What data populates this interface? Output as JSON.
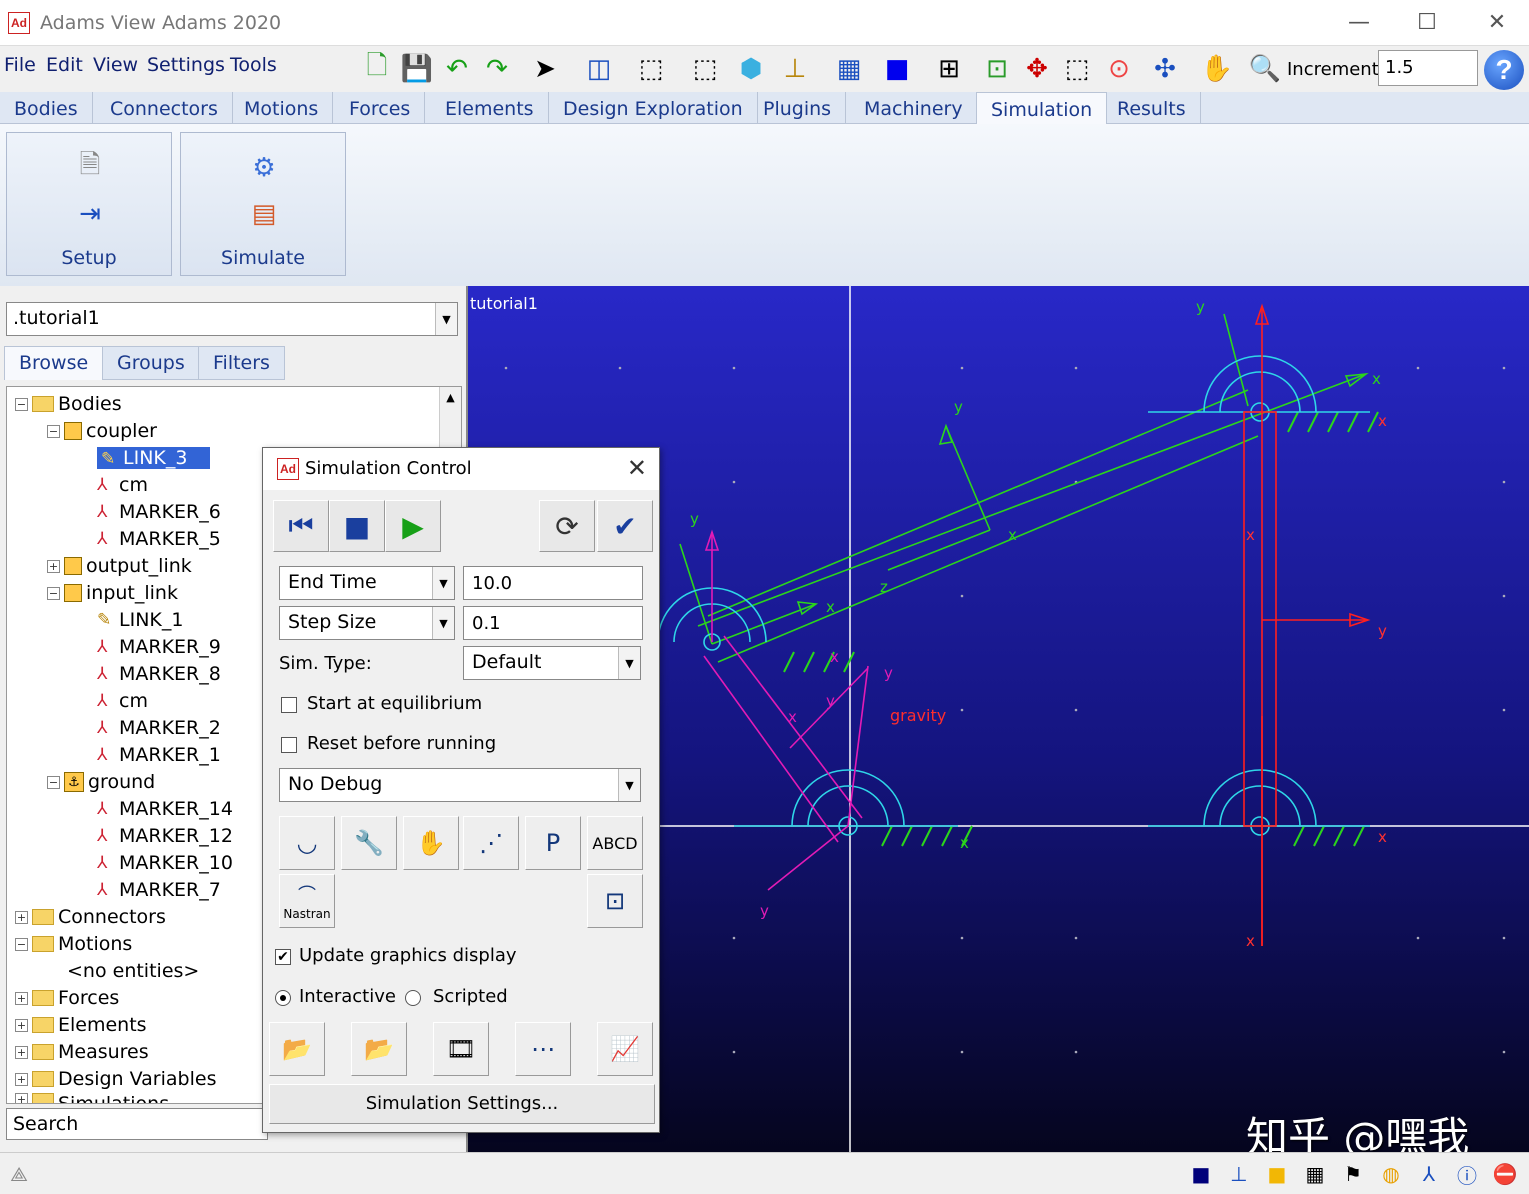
{
  "window": {
    "title": "Adams View Adams 2020",
    "logo": "Ad"
  },
  "menu": [
    "File",
    "Edit",
    "View",
    "Settings",
    "Tools"
  ],
  "toolbar": {
    "increment_label": "Increment",
    "increment_value": "1.5",
    "help": "?"
  },
  "ribbon_tabs": [
    "Bodies",
    "Connectors",
    "Motions",
    "Forces",
    "Elements",
    "Design Exploration",
    "Plugins",
    "Machinery",
    "Simulation",
    "Results"
  ],
  "ribbon_groups": {
    "setup": "Setup",
    "simulate": "Simulate"
  },
  "left": {
    "model": ".tutorial1",
    "tabs": [
      "Browse",
      "Groups",
      "Filters"
    ],
    "tree": {
      "bodies": "Bodies",
      "coupler": "coupler",
      "link3": "LINK_3",
      "cm1": "cm",
      "m6": "MARKER_6",
      "m5": "MARKER_5",
      "output_link": "output_link",
      "input_link": "input_link",
      "link1": "LINK_1",
      "m9": "MARKER_9",
      "m8": "MARKER_8",
      "cm2": "cm",
      "m2": "MARKER_2",
      "m1": "MARKER_1",
      "ground": "ground",
      "m14": "MARKER_14",
      "m12": "MARKER_12",
      "m10": "MARKER_10",
      "m7": "MARKER_7",
      "connectors": "Connectors",
      "motions": "Motions",
      "no_entities": "<no entities>",
      "forces": "Forces",
      "elements": "Elements",
      "measures": "Measures",
      "design_vars": "Design Variables",
      "simulations": "Simulations"
    },
    "search": "Search"
  },
  "viewport": {
    "model_label": "tutorial1",
    "gravity_label": "gravity",
    "watermark": "知乎 @嘿我"
  },
  "sim": {
    "title": "Simulation Control",
    "end_mode": "End Time",
    "end_value": "10.0",
    "step_mode": "Step Size",
    "step_value": "0.1",
    "sim_type_label": "Sim. Type:",
    "sim_type_value": "Default",
    "start_eq": "Start at equilibrium",
    "reset": "Reset before running",
    "debug": "No Debug",
    "nastran": "Nastran",
    "update_graphics": "Update graphics display",
    "interactive": "Interactive",
    "scripted": "Scripted",
    "settings_btn": "Simulation Settings..."
  },
  "colors": {
    "accent_tab": "#1b3a8c",
    "viewport_top": "#2828c8",
    "selection": "#3264d6"
  }
}
